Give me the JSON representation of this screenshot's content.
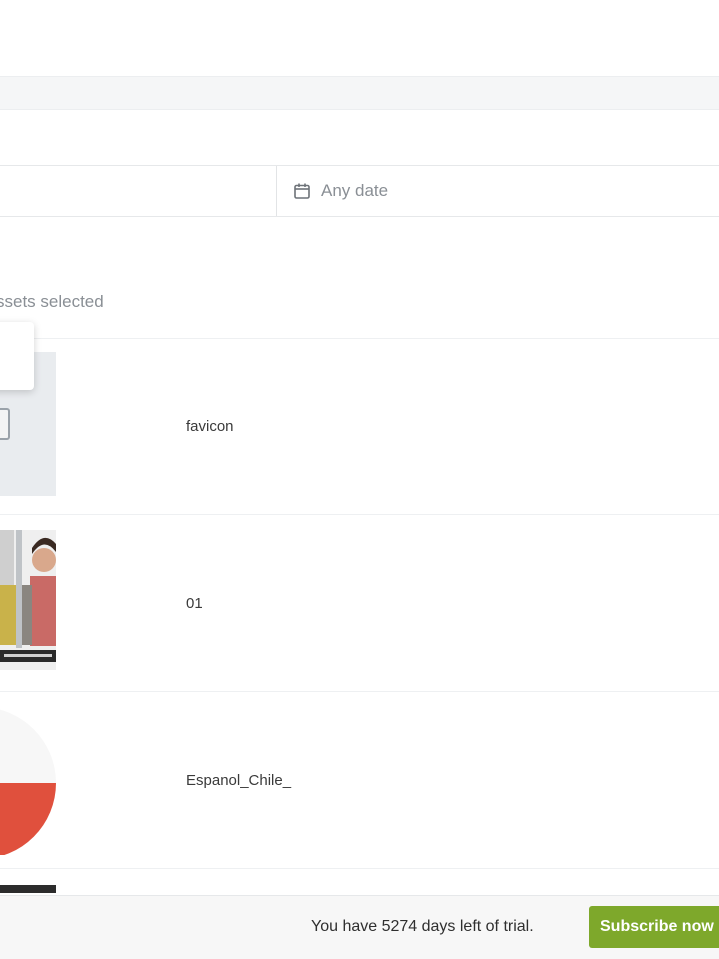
{
  "filters": {
    "date_label": "Any date",
    "date_icon": "calendar-icon"
  },
  "selection": {
    "text": "ssets selected"
  },
  "assets": [
    {
      "name": "favicon",
      "thumb": "file-icon"
    },
    {
      "name": "01",
      "thumb": "photo"
    },
    {
      "name": "Espanol_Chile_",
      "thumb": "red-circle-graphic"
    }
  ],
  "footer": {
    "trial_text": "You have 5274 days left of trial.",
    "subscribe_label": "Subscribe now"
  },
  "colors": {
    "subscribe_bg": "#7ea82b",
    "asset3_red": "#e0503d",
    "background": "#ffffff"
  }
}
